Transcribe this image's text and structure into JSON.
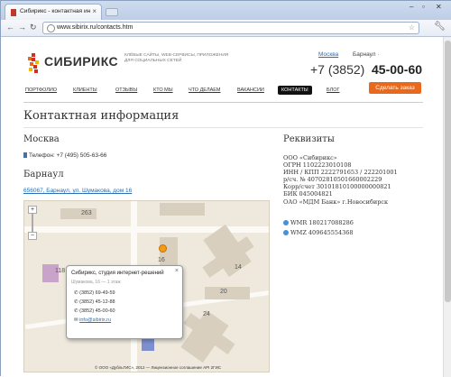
{
  "browser": {
    "tab_title": "Сибирикс - контактная ин",
    "url": "www.sibirix.ru/contacts.htm"
  },
  "header": {
    "logo_text": "СИБИРИКС",
    "tagline": "КЛЁВЫЕ САЙТЫ, WEB-СЕРВИСЫ, ПРИЛОЖЕНИЯ ДЛЯ СОЦИАЛЬНЫХ СЕТЕЙ",
    "city_link": "Москва",
    "city_current": "Барнаул ·",
    "phone_prefix": "+7 (3852)",
    "phone_main": "45-00-60",
    "order_button": "Сделать заказ"
  },
  "menu": [
    "ПОРТФОЛИО",
    "КЛИЕНТЫ",
    "ОТЗЫВЫ",
    "КТО МЫ",
    "ЧТО ДЕЛАЕМ",
    "ВАКАНСИИ",
    "КОНТАКТЫ",
    "БЛОГ"
  ],
  "main": {
    "title": "Контактная информация",
    "moscow_title": "Москва",
    "moscow_phone": "Телефон: +7 (495) 505-63-66",
    "barnaul_title": "Барнаул",
    "barnaul_address": "656067, Барнаул, ул. Шумакова, дом 16"
  },
  "requisites": {
    "title": "Реквизиты",
    "lines": [
      "ООО «Сибирикс»",
      "ОГРН 1102223010108",
      "ИНН / КПП 2222791653 / 222201001",
      "р/сч. № 40702810501660002229",
      "Корр/счет 30101810100000000821",
      "БИК 045004821",
      "ОАО «МДМ Банк» г.Новосибирск"
    ],
    "wmr": "WMR 180217088286",
    "wmz": "WMZ 409645554368"
  },
  "map": {
    "numbers": [
      "263",
      "118",
      "14",
      "20",
      "24",
      "16"
    ],
    "balloon_title": "Сибирикс, студия интернет-решений",
    "balloon_sub": "Шумакова, 16 — 1 этаж",
    "balloon_lines": [
      "(3852) 69-49-59",
      "(3852) 45-12-88",
      "(3852) 45-00-60"
    ],
    "balloon_email": "info@sibirix.ru",
    "footer": "© ООО «ДубльГИС», 2012 — Лицензионное соглашение   API 2ГИС"
  }
}
